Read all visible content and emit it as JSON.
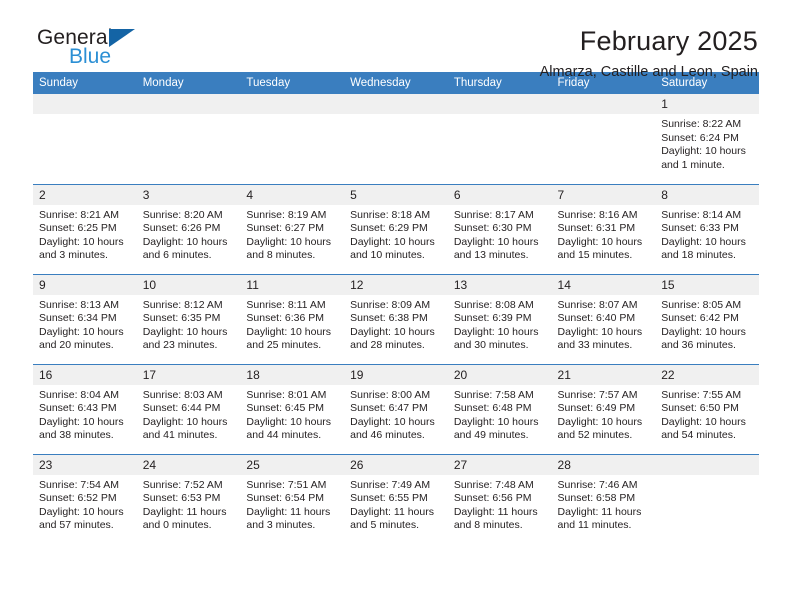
{
  "brand": {
    "name_top": "General",
    "name_bottom": "Blue",
    "flag_icon": "triangle-flag-icon",
    "accent_color": "#1464a5",
    "text_color": "#2b8fd4"
  },
  "header": {
    "title": "February 2025",
    "location": "Almarza, Castille and Leon, Spain"
  },
  "theme": {
    "header_blue": "#3a7ebf",
    "daynum_band": "#f0f0f0",
    "text": "#231f20"
  },
  "weekday_headers": [
    "Sunday",
    "Monday",
    "Tuesday",
    "Wednesday",
    "Thursday",
    "Friday",
    "Saturday"
  ],
  "weeks": [
    [
      {
        "day": "",
        "sunrise": "",
        "sunset": "",
        "daylight_1": "",
        "daylight_2": "",
        "empty": true
      },
      {
        "day": "",
        "sunrise": "",
        "sunset": "",
        "daylight_1": "",
        "daylight_2": "",
        "empty": true
      },
      {
        "day": "",
        "sunrise": "",
        "sunset": "",
        "daylight_1": "",
        "daylight_2": "",
        "empty": true
      },
      {
        "day": "",
        "sunrise": "",
        "sunset": "",
        "daylight_1": "",
        "daylight_2": "",
        "empty": true
      },
      {
        "day": "",
        "sunrise": "",
        "sunset": "",
        "daylight_1": "",
        "daylight_2": "",
        "empty": true
      },
      {
        "day": "",
        "sunrise": "",
        "sunset": "",
        "daylight_1": "",
        "daylight_2": "",
        "empty": true
      },
      {
        "day": "1",
        "sunrise": "Sunrise: 8:22 AM",
        "sunset": "Sunset: 6:24 PM",
        "daylight_1": "Daylight: 10 hours",
        "daylight_2": "and 1 minute.",
        "empty": false
      }
    ],
    [
      {
        "day": "2",
        "sunrise": "Sunrise: 8:21 AM",
        "sunset": "Sunset: 6:25 PM",
        "daylight_1": "Daylight: 10 hours",
        "daylight_2": "and 3 minutes.",
        "empty": false
      },
      {
        "day": "3",
        "sunrise": "Sunrise: 8:20 AM",
        "sunset": "Sunset: 6:26 PM",
        "daylight_1": "Daylight: 10 hours",
        "daylight_2": "and 6 minutes.",
        "empty": false
      },
      {
        "day": "4",
        "sunrise": "Sunrise: 8:19 AM",
        "sunset": "Sunset: 6:27 PM",
        "daylight_1": "Daylight: 10 hours",
        "daylight_2": "and 8 minutes.",
        "empty": false
      },
      {
        "day": "5",
        "sunrise": "Sunrise: 8:18 AM",
        "sunset": "Sunset: 6:29 PM",
        "daylight_1": "Daylight: 10 hours",
        "daylight_2": "and 10 minutes.",
        "empty": false
      },
      {
        "day": "6",
        "sunrise": "Sunrise: 8:17 AM",
        "sunset": "Sunset: 6:30 PM",
        "daylight_1": "Daylight: 10 hours",
        "daylight_2": "and 13 minutes.",
        "empty": false
      },
      {
        "day": "7",
        "sunrise": "Sunrise: 8:16 AM",
        "sunset": "Sunset: 6:31 PM",
        "daylight_1": "Daylight: 10 hours",
        "daylight_2": "and 15 minutes.",
        "empty": false
      },
      {
        "day": "8",
        "sunrise": "Sunrise: 8:14 AM",
        "sunset": "Sunset: 6:33 PM",
        "daylight_1": "Daylight: 10 hours",
        "daylight_2": "and 18 minutes.",
        "empty": false
      }
    ],
    [
      {
        "day": "9",
        "sunrise": "Sunrise: 8:13 AM",
        "sunset": "Sunset: 6:34 PM",
        "daylight_1": "Daylight: 10 hours",
        "daylight_2": "and 20 minutes.",
        "empty": false
      },
      {
        "day": "10",
        "sunrise": "Sunrise: 8:12 AM",
        "sunset": "Sunset: 6:35 PM",
        "daylight_1": "Daylight: 10 hours",
        "daylight_2": "and 23 minutes.",
        "empty": false
      },
      {
        "day": "11",
        "sunrise": "Sunrise: 8:11 AM",
        "sunset": "Sunset: 6:36 PM",
        "daylight_1": "Daylight: 10 hours",
        "daylight_2": "and 25 minutes.",
        "empty": false
      },
      {
        "day": "12",
        "sunrise": "Sunrise: 8:09 AM",
        "sunset": "Sunset: 6:38 PM",
        "daylight_1": "Daylight: 10 hours",
        "daylight_2": "and 28 minutes.",
        "empty": false
      },
      {
        "day": "13",
        "sunrise": "Sunrise: 8:08 AM",
        "sunset": "Sunset: 6:39 PM",
        "daylight_1": "Daylight: 10 hours",
        "daylight_2": "and 30 minutes.",
        "empty": false
      },
      {
        "day": "14",
        "sunrise": "Sunrise: 8:07 AM",
        "sunset": "Sunset: 6:40 PM",
        "daylight_1": "Daylight: 10 hours",
        "daylight_2": "and 33 minutes.",
        "empty": false
      },
      {
        "day": "15",
        "sunrise": "Sunrise: 8:05 AM",
        "sunset": "Sunset: 6:42 PM",
        "daylight_1": "Daylight: 10 hours",
        "daylight_2": "and 36 minutes.",
        "empty": false
      }
    ],
    [
      {
        "day": "16",
        "sunrise": "Sunrise: 8:04 AM",
        "sunset": "Sunset: 6:43 PM",
        "daylight_1": "Daylight: 10 hours",
        "daylight_2": "and 38 minutes.",
        "empty": false
      },
      {
        "day": "17",
        "sunrise": "Sunrise: 8:03 AM",
        "sunset": "Sunset: 6:44 PM",
        "daylight_1": "Daylight: 10 hours",
        "daylight_2": "and 41 minutes.",
        "empty": false
      },
      {
        "day": "18",
        "sunrise": "Sunrise: 8:01 AM",
        "sunset": "Sunset: 6:45 PM",
        "daylight_1": "Daylight: 10 hours",
        "daylight_2": "and 44 minutes.",
        "empty": false
      },
      {
        "day": "19",
        "sunrise": "Sunrise: 8:00 AM",
        "sunset": "Sunset: 6:47 PM",
        "daylight_1": "Daylight: 10 hours",
        "daylight_2": "and 46 minutes.",
        "empty": false
      },
      {
        "day": "20",
        "sunrise": "Sunrise: 7:58 AM",
        "sunset": "Sunset: 6:48 PM",
        "daylight_1": "Daylight: 10 hours",
        "daylight_2": "and 49 minutes.",
        "empty": false
      },
      {
        "day": "21",
        "sunrise": "Sunrise: 7:57 AM",
        "sunset": "Sunset: 6:49 PM",
        "daylight_1": "Daylight: 10 hours",
        "daylight_2": "and 52 minutes.",
        "empty": false
      },
      {
        "day": "22",
        "sunrise": "Sunrise: 7:55 AM",
        "sunset": "Sunset: 6:50 PM",
        "daylight_1": "Daylight: 10 hours",
        "daylight_2": "and 54 minutes.",
        "empty": false
      }
    ],
    [
      {
        "day": "23",
        "sunrise": "Sunrise: 7:54 AM",
        "sunset": "Sunset: 6:52 PM",
        "daylight_1": "Daylight: 10 hours",
        "daylight_2": "and 57 minutes.",
        "empty": false
      },
      {
        "day": "24",
        "sunrise": "Sunrise: 7:52 AM",
        "sunset": "Sunset: 6:53 PM",
        "daylight_1": "Daylight: 11 hours",
        "daylight_2": "and 0 minutes.",
        "empty": false
      },
      {
        "day": "25",
        "sunrise": "Sunrise: 7:51 AM",
        "sunset": "Sunset: 6:54 PM",
        "daylight_1": "Daylight: 11 hours",
        "daylight_2": "and 3 minutes.",
        "empty": false
      },
      {
        "day": "26",
        "sunrise": "Sunrise: 7:49 AM",
        "sunset": "Sunset: 6:55 PM",
        "daylight_1": "Daylight: 11 hours",
        "daylight_2": "and 5 minutes.",
        "empty": false
      },
      {
        "day": "27",
        "sunrise": "Sunrise: 7:48 AM",
        "sunset": "Sunset: 6:56 PM",
        "daylight_1": "Daylight: 11 hours",
        "daylight_2": "and 8 minutes.",
        "empty": false
      },
      {
        "day": "28",
        "sunrise": "Sunrise: 7:46 AM",
        "sunset": "Sunset: 6:58 PM",
        "daylight_1": "Daylight: 11 hours",
        "daylight_2": "and 11 minutes.",
        "empty": false
      },
      {
        "day": "",
        "sunrise": "",
        "sunset": "",
        "daylight_1": "",
        "daylight_2": "",
        "empty": true
      }
    ]
  ]
}
